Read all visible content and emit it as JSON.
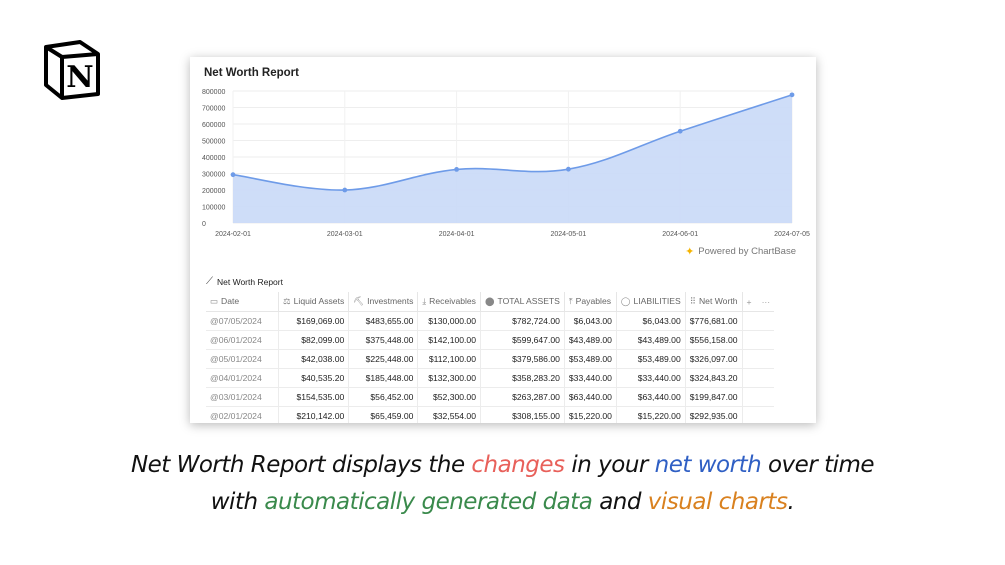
{
  "logo": {
    "icon": "notion-logo-icon",
    "letter": "N"
  },
  "chart_title": "Net Worth Report",
  "chart_data": {
    "type": "area",
    "x": [
      "2024-02-01",
      "2024-03-01",
      "2024-04-01",
      "2024-05-01",
      "2024-06-01",
      "2024-07-05"
    ],
    "values": [
      292935,
      199847,
      324843,
      326097,
      556158,
      776681
    ],
    "y_ticks": [
      "800000",
      "700000",
      "600000",
      "500000",
      "400000",
      "300000",
      "200000",
      "100000",
      "0"
    ],
    "ylim": [
      0,
      800000
    ],
    "grid": true,
    "line_color": "#6e9be8",
    "fill_color": "#c9d9f7"
  },
  "powered_by": "Powered by ChartBase",
  "table": {
    "title": "Net Worth Report",
    "columns": [
      {
        "label": "Date",
        "icon": "calendar-icon",
        "glyph": "▭"
      },
      {
        "label": "Liquid Assets",
        "icon": "bank-icon",
        "glyph": "⚖"
      },
      {
        "label": "Investments",
        "icon": "chart-icon",
        "glyph": "⛏"
      },
      {
        "label": "Receivables",
        "icon": "download-icon",
        "glyph": "⤓"
      },
      {
        "label": "TOTAL ASSETS",
        "icon": "formula-icon",
        "glyph": "⬤"
      },
      {
        "label": "Payables",
        "icon": "upload-icon",
        "glyph": "⤒"
      },
      {
        "label": "LIABILITIES",
        "icon": "circle-icon",
        "glyph": "◯"
      },
      {
        "label": "Net Worth",
        "icon": "grid-icon",
        "glyph": "⠿"
      }
    ],
    "add_label": "+",
    "more_label": "···",
    "rows": [
      [
        "@07/05/2024",
        "$169,069.00",
        "$483,655.00",
        "$130,000.00",
        "$782,724.00",
        "$6,043.00",
        "$6,043.00",
        "$776,681.00"
      ],
      [
        "@06/01/2024",
        "$82,099.00",
        "$375,448.00",
        "$142,100.00",
        "$599,647.00",
        "$43,489.00",
        "$43,489.00",
        "$556,158.00"
      ],
      [
        "@05/01/2024",
        "$42,038.00",
        "$225,448.00",
        "$112,100.00",
        "$379,586.00",
        "$53,489.00",
        "$53,489.00",
        "$326,097.00"
      ],
      [
        "@04/01/2024",
        "$40,535.20",
        "$185,448.00",
        "$132,300.00",
        "$358,283.20",
        "$33,440.00",
        "$33,440.00",
        "$324,843.20"
      ],
      [
        "@03/01/2024",
        "$154,535.00",
        "$56,452.00",
        "$52,300.00",
        "$263,287.00",
        "$63,440.00",
        "$63,440.00",
        "$199,847.00"
      ],
      [
        "@02/01/2024",
        "$210,142.00",
        "$65,459.00",
        "$32,554.00",
        "$308,155.00",
        "$15,220.00",
        "$15,220.00",
        "$292,935.00"
      ]
    ]
  },
  "caption": {
    "line1": [
      {
        "text": "Net Worth Report displays the ",
        "color": "#111111"
      },
      {
        "text": "changes",
        "color": "#e8605a"
      },
      {
        "text": " in your ",
        "color": "#111111"
      },
      {
        "text": "net worth",
        "color": "#2f5fc4"
      },
      {
        "text": " over time",
        "color": "#111111"
      }
    ],
    "line2": [
      {
        "text": "with ",
        "color": "#111111"
      },
      {
        "text": "automatically generated data",
        "color": "#3a8a4c"
      },
      {
        "text": " and ",
        "color": "#111111"
      },
      {
        "text": "visual charts",
        "color": "#d9811f"
      },
      {
        "text": ".",
        "color": "#111111"
      }
    ]
  }
}
